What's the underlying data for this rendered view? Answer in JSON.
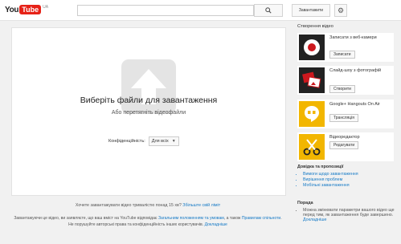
{
  "header": {
    "logo_you": "You",
    "logo_tube": "Tube",
    "logo_region": "UA",
    "upload_button_label": "Завантажити",
    "settings_icon": "gear-icon",
    "search_icon": "search-icon"
  },
  "upload": {
    "title": "Виберіть файли для завантаження",
    "subtitle": "Або перетягніть відеофайли",
    "privacy_label": "Конфіденційність:",
    "privacy_value": "Для всіх"
  },
  "footer": {
    "speed_text": "Хочете завантажувати відео тривалістю понад 15 хв?",
    "speed_link": "Збільште свій ліміт",
    "legal_line1": "Завантажуючи це відео, ви заявляєте, що ваш вміст на YouTube відповідає",
    "legal_link1": "Загальним положенням та умовам",
    "legal_mid": ", а також",
    "legal_link2": "Правилам спільноти",
    "legal_line2": "Не порушуйте авторські права та конфіденційність інших користувачів.",
    "legal_link3": "Докладніше"
  },
  "sidebar": {
    "title": "Створення відео",
    "cards": [
      {
        "title": "Записати з веб-камери",
        "button": "Записати",
        "icon": "webcam-record-icon",
        "color": "#cc181e"
      },
      {
        "title": "Слайд-шоу з фотографій",
        "button": "Створити",
        "icon": "photos-icon",
        "color": "#cc181e"
      },
      {
        "title": "Google+ Hangouts On Air",
        "button": "Трансляція",
        "icon": "hangouts-icon",
        "color": "#f2b600"
      },
      {
        "title": "Відеоредактор",
        "button": "Редагувати",
        "icon": "scissors-icon",
        "color": "#f2b600"
      }
    ],
    "help_title": "Довідка та пропозиції",
    "help_items": [
      "Вимоги щодо завантаження",
      "Вирішення проблем",
      "Мобільні завантаження"
    ],
    "tip_title": "Порада",
    "tip_text": "Можна змінювати параметри вашого відео ще перед тим, як завантаження буде завершено.",
    "tip_link": "Докладніше"
  }
}
